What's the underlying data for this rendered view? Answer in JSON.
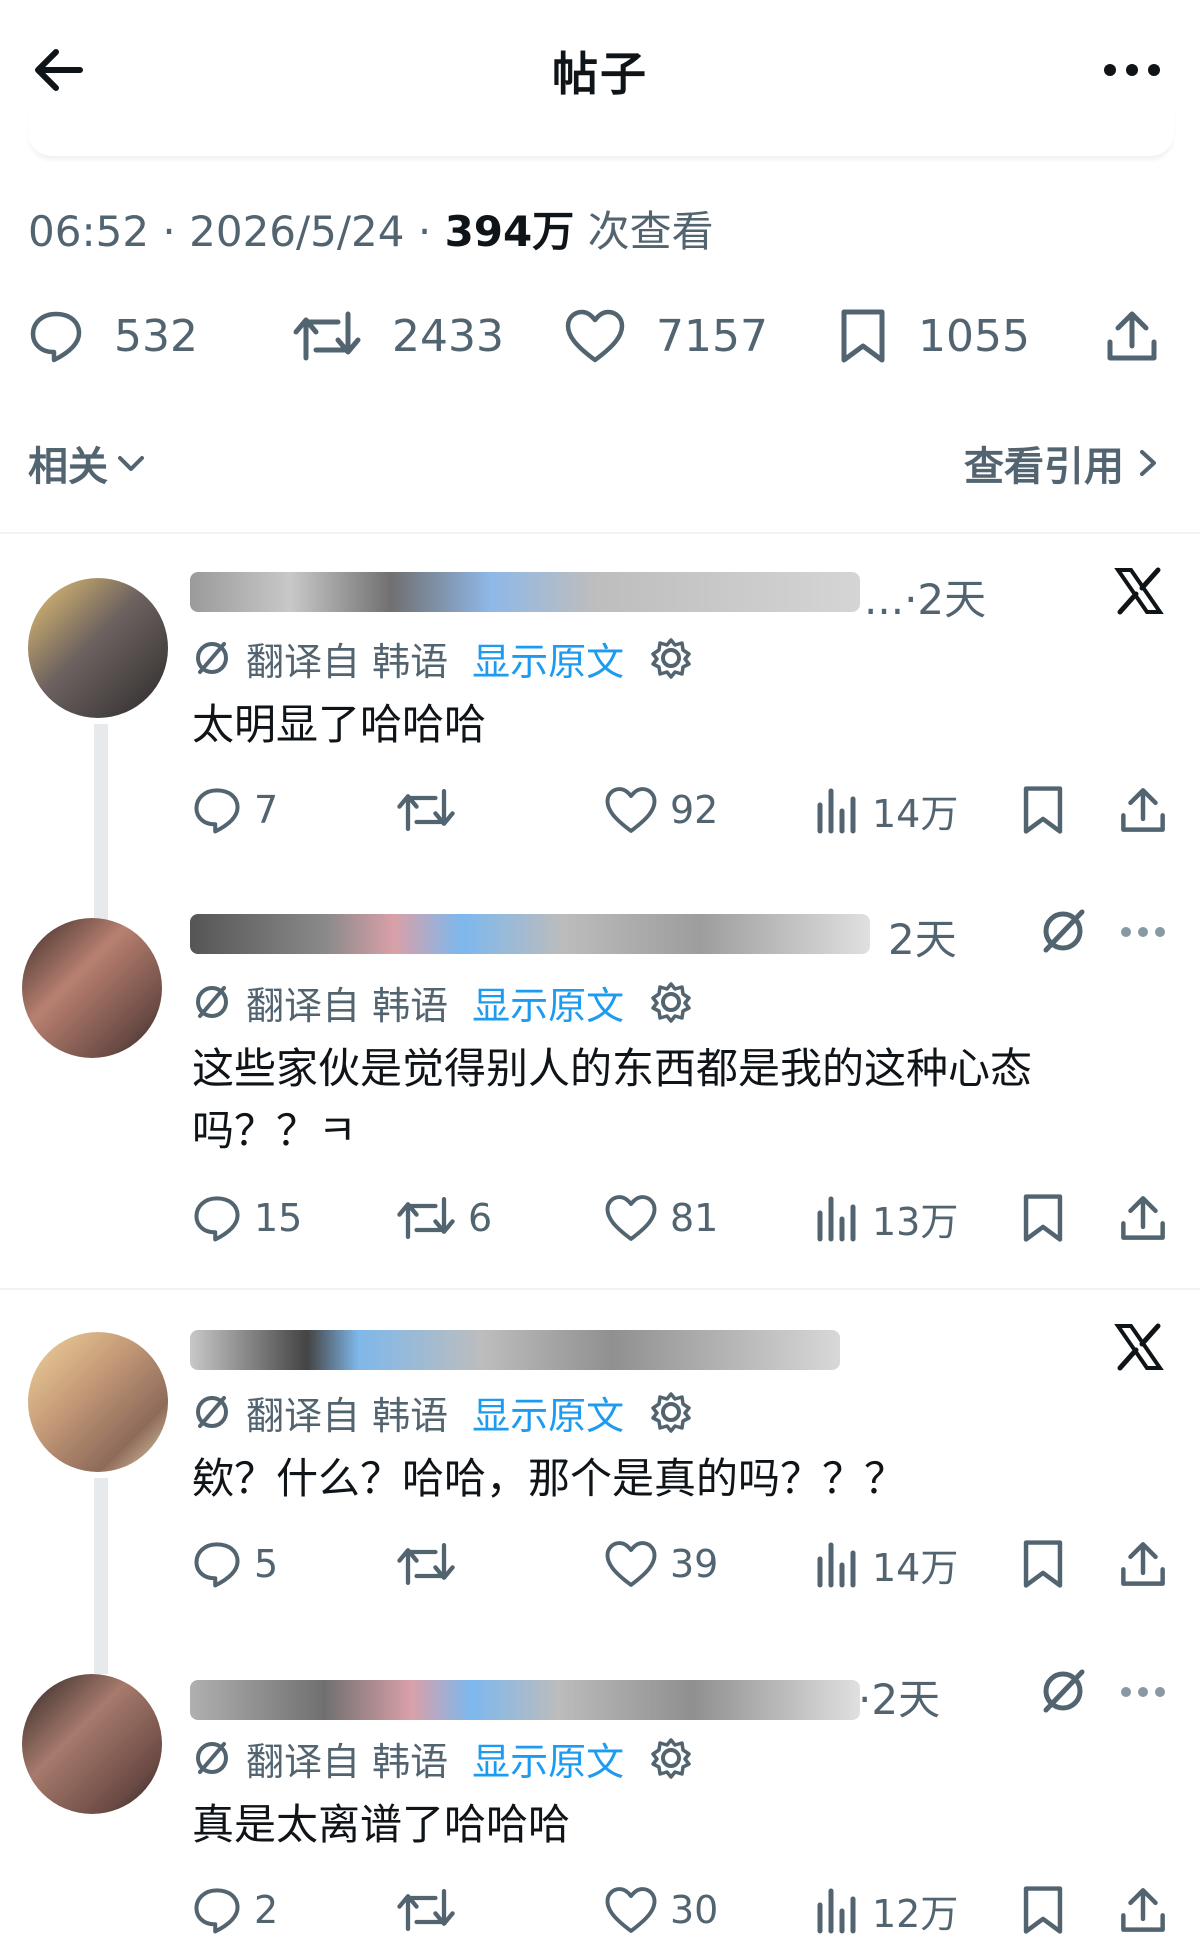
{
  "header": {
    "title": "帖子"
  },
  "post": {
    "time": "06:52",
    "sep1": "·",
    "date": "2026/5/24",
    "sep2": "·",
    "views_count": "394万",
    "views_label": "次查看",
    "stats": {
      "replies": "532",
      "reposts": "2433",
      "likes": "7157",
      "bookmarks": "1055"
    }
  },
  "filters": {
    "related_label": "相关",
    "quotes_label": "查看引用"
  },
  "translate_common": {
    "label": "翻译自 韩语",
    "show_original": "显示原文"
  },
  "replies": [
    {
      "time": "·2天",
      "ellipsis": "...",
      "text": "太明显了哈哈哈",
      "actions": {
        "replies": "7",
        "reposts": "",
        "likes": "92",
        "views": "14万"
      }
    },
    {
      "time": "2天",
      "ellipsis": "",
      "text": "这些家伙是觉得别人的东西都是我的这种心态吗？？ㅋ",
      "actions": {
        "replies": "15",
        "reposts": "6",
        "likes": "81",
        "views": "13万"
      }
    },
    {
      "time": "",
      "ellipsis": "",
      "text": "欸？什么？哈哈，那个是真的吗？？？",
      "actions": {
        "replies": "5",
        "reposts": "",
        "likes": "39",
        "views": "14万"
      }
    },
    {
      "time": "·2天",
      "ellipsis": "",
      "text": "真是太离谱了哈哈哈",
      "actions": {
        "replies": "2",
        "reposts": "",
        "likes": "30",
        "views": "12万"
      }
    }
  ],
  "icons": [
    "back-arrow-icon",
    "more-icon",
    "reply-icon",
    "repost-icon",
    "like-icon",
    "bookmark-icon",
    "share-icon",
    "views-icon",
    "x-logo-icon",
    "grok-icon",
    "translate-icon",
    "gear-icon",
    "chevron-down-icon",
    "chevron-right-icon"
  ],
  "colors": {
    "text": "#0f1419",
    "secondary": "#536471",
    "link": "#1d9bf0",
    "divider": "#eff3f4"
  }
}
